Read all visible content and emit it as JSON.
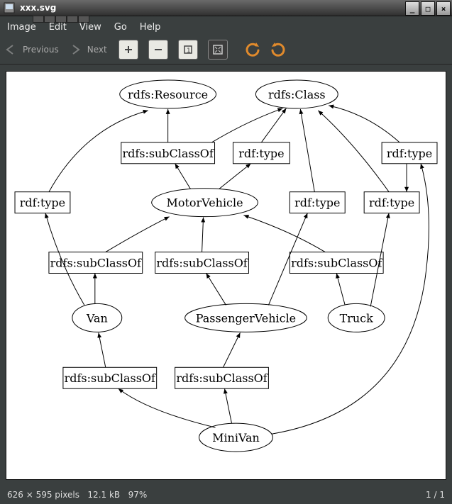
{
  "titlebar": {
    "title": "xxx.svg"
  },
  "menubar": [
    "Image",
    "Edit",
    "View",
    "Go",
    "Help"
  ],
  "toolbar": {
    "previous": "Previous",
    "next": "Next"
  },
  "status": {
    "dimensions": "626 × 595 pixels",
    "filesize": "12.1 kB",
    "zoom": "97%",
    "page": "1 / 1"
  },
  "graph": {
    "labels": {
      "subClassOf": "rdfs:subClassOf",
      "type": "rdf:type"
    },
    "nodes": {
      "resource": "rdfs:Resource",
      "class": "rdfs:Class",
      "motorVehicle": "MotorVehicle",
      "van": "Van",
      "passengerVehicle": "PassengerVehicle",
      "truck": "Truck",
      "miniVan": "MiniVan"
    },
    "edges": [
      {
        "from": "MotorVehicle",
        "label": "rdfs:subClassOf",
        "to": "rdfs:Resource"
      },
      {
        "from": "MotorVehicle",
        "label": "rdf:type",
        "to": "rdfs:Class"
      },
      {
        "from": "rdfs:subClassOf(1)",
        "label": "",
        "to": "rdfs:Class"
      },
      {
        "from": "Van",
        "label": "rdf:type",
        "to": "rdfs:Class"
      },
      {
        "from": "Van",
        "label": "rdfs:subClassOf",
        "to": "MotorVehicle"
      },
      {
        "from": "PassengerVehicle",
        "label": "rdfs:subClassOf",
        "to": "MotorVehicle"
      },
      {
        "from": "PassengerVehicle",
        "label": "rdf:type",
        "to": "rdfs:Class"
      },
      {
        "from": "Truck",
        "label": "rdfs:subClassOf",
        "to": "MotorVehicle"
      },
      {
        "from": "Truck",
        "label": "rdf:type",
        "to": "rdfs:Class"
      },
      {
        "from": "MiniVan",
        "label": "rdfs:subClassOf",
        "to": "Van"
      },
      {
        "from": "MiniVan",
        "label": "rdfs:subClassOf",
        "to": "PassengerVehicle"
      },
      {
        "from": "MiniVan",
        "label": "rdf:type",
        "to": "rdfs:Class"
      }
    ]
  }
}
